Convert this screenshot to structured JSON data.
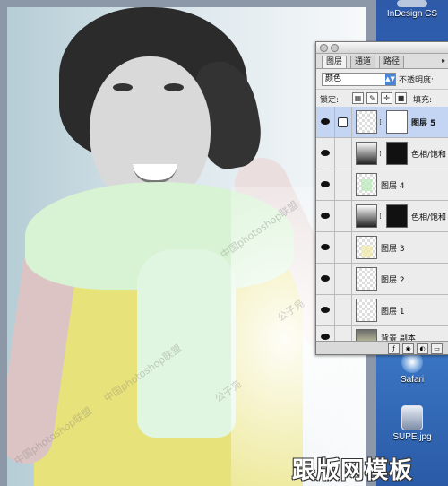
{
  "desktop": {
    "icons": [
      {
        "name": "indesign-app-icon",
        "label": "InDesign CS"
      },
      {
        "name": "safari-app-icon",
        "label": "Safari"
      },
      {
        "name": "jpg-file-icon",
        "label": "SUPE.jpg"
      }
    ]
  },
  "layers_panel": {
    "tabs": [
      "图层",
      "通道",
      "路径"
    ],
    "active_tab": "图层",
    "blend_mode": "颜色",
    "opacity_label": "不透明度:",
    "lock_label": "锁定:",
    "fill_label": "填充:",
    "layers": [
      {
        "name": "图层 5",
        "selected": true,
        "type": "pixel-with-mask"
      },
      {
        "name": "色相/饱和",
        "selected": false,
        "type": "adjustment"
      },
      {
        "name": "图层 4",
        "selected": false,
        "type": "pixel"
      },
      {
        "name": "色相/饱和",
        "selected": false,
        "type": "adjustment"
      },
      {
        "name": "图层 3",
        "selected": false,
        "type": "pixel"
      },
      {
        "name": "图层 2",
        "selected": false,
        "type": "pixel"
      },
      {
        "name": "图层 1",
        "selected": false,
        "type": "pixel"
      },
      {
        "name": "背景 副本",
        "selected": false,
        "type": "photo"
      }
    ]
  },
  "watermarks": {
    "site": "中国photoshop联盟",
    "author": "公子凫"
  },
  "brand_text": "跟版网模板",
  "colors": {
    "desktop_blue": "#2c6ac4",
    "selected_layer": "#c3d5f2",
    "shirt_yellow": "#e8e27a",
    "sweater_green": "#d8f3d4"
  }
}
